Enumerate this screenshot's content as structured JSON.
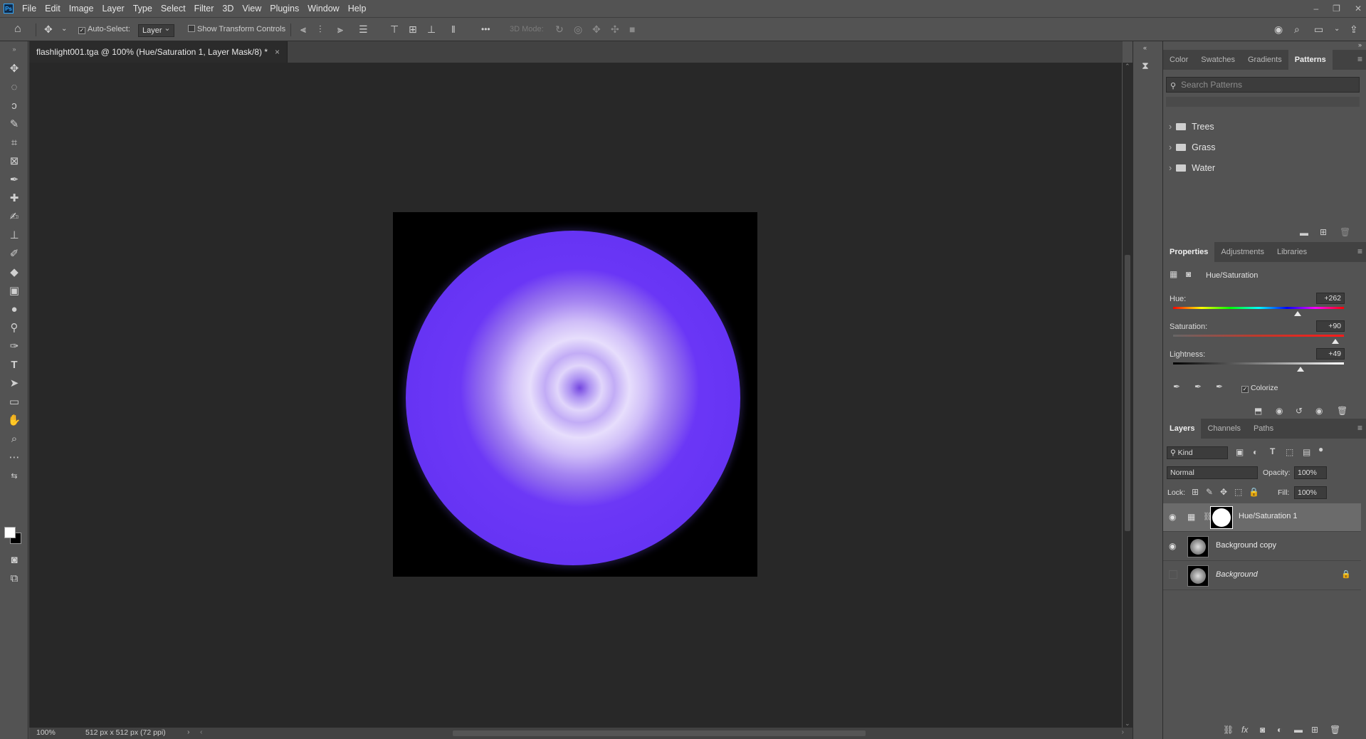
{
  "app": {
    "logo": "Ps",
    "menus": [
      "File",
      "Edit",
      "Image",
      "Layer",
      "Type",
      "Select",
      "Filter",
      "3D",
      "View",
      "Plugins",
      "Window",
      "Help"
    ],
    "window_controls": [
      "–",
      "❐",
      "✕"
    ]
  },
  "options_bar": {
    "auto_select_label": "Auto-Select:",
    "auto_select_checked": true,
    "auto_select_target": "Layer",
    "show_transform_label": "Show Transform Controls",
    "three_d_mode_label": "3D Mode:",
    "more_label": "•••"
  },
  "document": {
    "tab_title": "flashlight001.tga @ 100% (Hue/Saturation 1, Layer Mask/8) *",
    "close": "×",
    "zoom": "100%",
    "dimensions": "512 px x 512 px (72 ppi)"
  },
  "patterns_panel": {
    "tabs": [
      "Color",
      "Swatches",
      "Gradients",
      "Patterns"
    ],
    "active_tab": "Patterns",
    "search_placeholder": "Search Patterns",
    "groups": [
      {
        "label": "Trees"
      },
      {
        "label": "Grass"
      },
      {
        "label": "Water"
      }
    ]
  },
  "properties_panel": {
    "tabs": [
      "Properties",
      "Adjustments",
      "Libraries"
    ],
    "active_tab": "Properties",
    "adjustment_title": "Hue/Saturation",
    "hue": {
      "label": "Hue:",
      "value": "+262",
      "fraction": 0.73
    },
    "saturation": {
      "label": "Saturation:",
      "value": "+90",
      "fraction": 0.95
    },
    "lightness": {
      "label": "Lightness:",
      "value": "+49",
      "fraction": 0.745
    },
    "colorize_label": "Colorize",
    "colorize_checked": true
  },
  "layers_panel": {
    "tabs": [
      "Layers",
      "Channels",
      "Paths"
    ],
    "active_tab": "Layers",
    "filter_kind": "Kind",
    "blend_mode": "Normal",
    "opacity_label": "Opacity:",
    "opacity_value": "100%",
    "lock_label": "Lock:",
    "fill_label": "Fill:",
    "fill_value": "100%",
    "layers": [
      {
        "name": "Hue/Saturation 1",
        "visible": true,
        "selected": true
      },
      {
        "name": "Background copy",
        "visible": true,
        "selected": false
      },
      {
        "name": "Background",
        "visible": false,
        "selected": false,
        "locked": true
      }
    ]
  },
  "colors": {
    "panel_bg": "#535353",
    "canvas_bg": "#282828",
    "orb_purple": "#6a36f6",
    "accent_blue": "#31a8ff"
  }
}
